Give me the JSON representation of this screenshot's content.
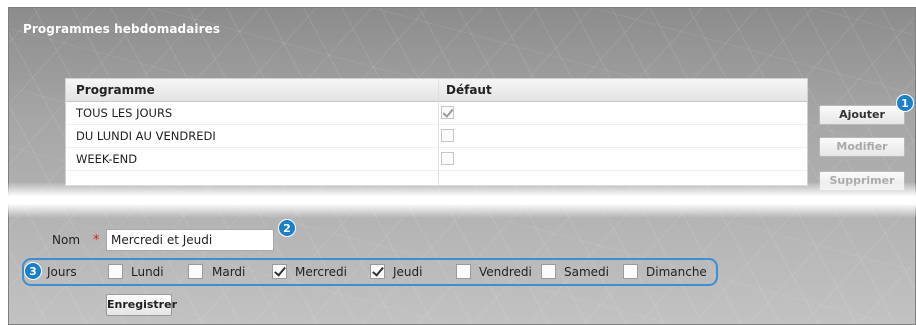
{
  "panel": {
    "title": "Programmes hebdomadaires"
  },
  "table": {
    "headers": {
      "programme": "Programme",
      "default": "Défaut"
    },
    "rows": [
      {
        "name": "TOUS LES JOURS",
        "default": true
      },
      {
        "name": "DU LUNDI AU VENDREDI",
        "default": false
      },
      {
        "name": "WEEK-END",
        "default": false
      }
    ]
  },
  "buttons": {
    "add": "Ajouter",
    "edit": "Modifier",
    "delete": "Supprimer",
    "save": "Enregistrer"
  },
  "badges": {
    "b1": "1",
    "b2": "2",
    "b3": "3"
  },
  "form": {
    "name_label": "Nom",
    "required_mark": "*",
    "name_value": "Mercredi et Jeudi",
    "days_label": "Jours",
    "days": [
      {
        "label": "Lundi",
        "checked": false
      },
      {
        "label": "Mardi",
        "checked": false
      },
      {
        "label": "Mercredi",
        "checked": true
      },
      {
        "label": "Jeudi",
        "checked": true
      },
      {
        "label": "Vendredi",
        "checked": false
      },
      {
        "label": "Samedi",
        "checked": false
      },
      {
        "label": "Dimanche",
        "checked": false
      }
    ]
  },
  "colors": {
    "accent": "#1c7fcb",
    "required": "#e02020"
  }
}
